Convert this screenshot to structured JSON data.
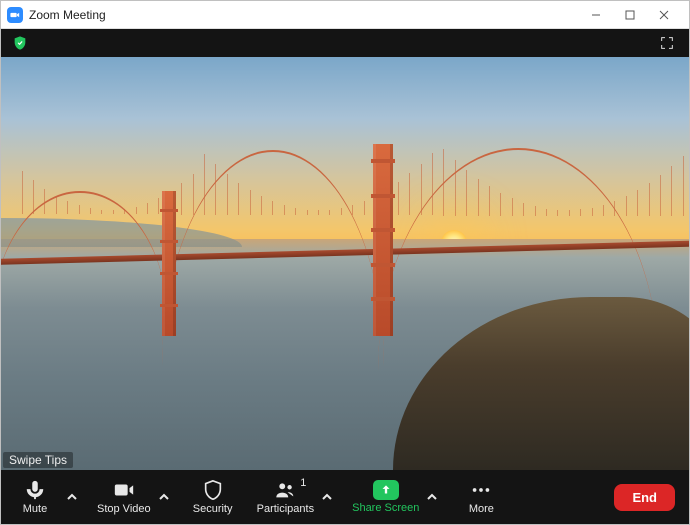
{
  "window": {
    "title": "Zoom Meeting"
  },
  "overlay": {
    "swipe_tips": "Swipe Tips"
  },
  "controls": {
    "mute": "Mute",
    "stop_video": "Stop Video",
    "security": "Security",
    "participants": "Participants",
    "participant_count": "1",
    "share_screen": "Share Screen",
    "more": "More",
    "end": "End"
  },
  "icons": {
    "shield_color": "#22c55e",
    "share_bg": "#22c55e",
    "end_bg": "#dc2626"
  }
}
